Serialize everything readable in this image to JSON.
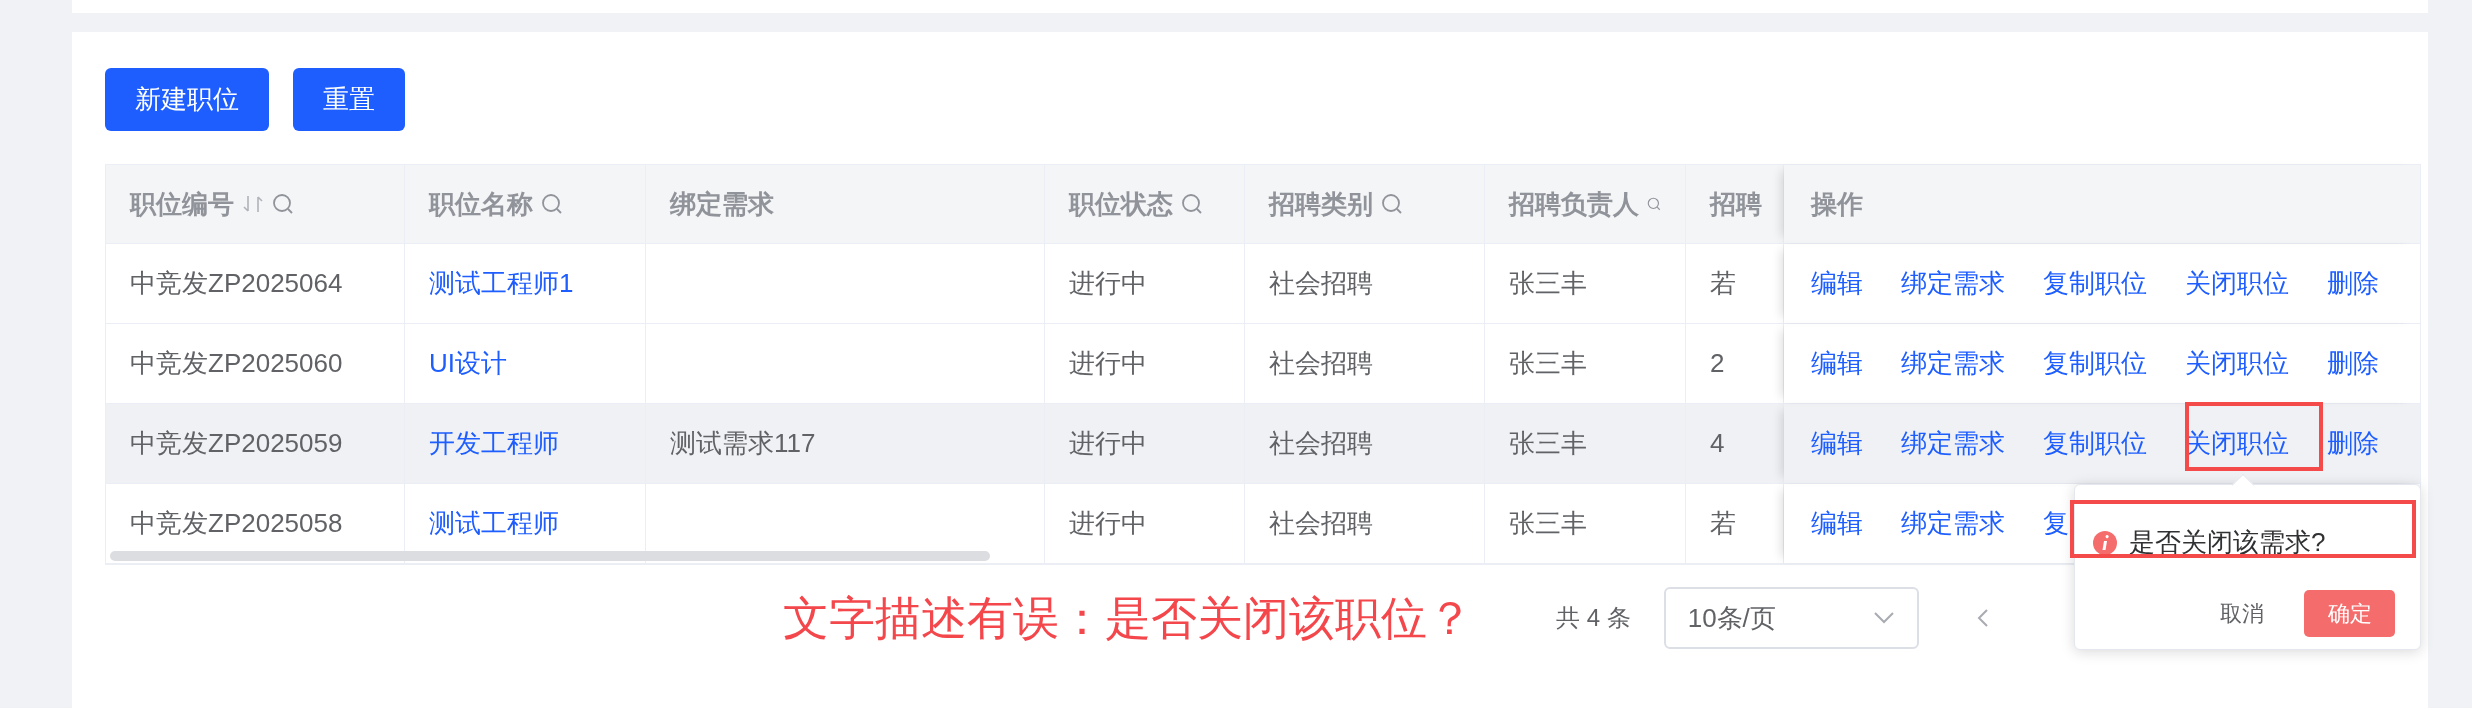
{
  "buttons": [
    {
      "label": "新建职位"
    },
    {
      "label": "重置"
    }
  ],
  "table": {
    "columns": [
      {
        "label": "职位编号",
        "kind": "text",
        "sort": true,
        "search": true
      },
      {
        "label": "职位名称",
        "kind": "link",
        "sort": false,
        "search": true
      },
      {
        "label": "绑定需求",
        "kind": "text",
        "sort": false,
        "search": false
      },
      {
        "label": "职位状态",
        "kind": "text",
        "sort": false,
        "search": true
      },
      {
        "label": "招聘类别",
        "kind": "text",
        "sort": false,
        "search": true
      },
      {
        "label": "招聘负责人",
        "kind": "text",
        "sort": false,
        "search": true
      },
      {
        "label": "招聘",
        "kind": "text",
        "sort": false,
        "search": false
      }
    ],
    "actions_header": "操作",
    "rows": [
      {
        "highlighted": false,
        "cells": [
          "中竞发ZP2025064",
          "测试工程师1",
          "",
          "进行中",
          "社会招聘",
          "张三丰",
          "若"
        ],
        "actions": [
          "编辑",
          "绑定需求",
          "复制职位",
          "关闭职位",
          "删除"
        ]
      },
      {
        "highlighted": false,
        "cells": [
          "中竞发ZP2025060",
          "UI设计",
          "",
          "进行中",
          "社会招聘",
          "张三丰",
          "2"
        ],
        "actions": [
          "编辑",
          "绑定需求",
          "复制职位",
          "关闭职位",
          "删除"
        ]
      },
      {
        "highlighted": true,
        "cells": [
          "中竞发ZP2025059",
          "开发工程师",
          "测试需求117",
          "进行中",
          "社会招聘",
          "张三丰",
          "4"
        ],
        "actions": [
          "编辑",
          "绑定需求",
          "复制职位",
          "关闭职位",
          "删除"
        ]
      },
      {
        "highlighted": false,
        "cells": [
          "中竞发ZP2025058",
          "测试工程师",
          "",
          "进行中",
          "社会招聘",
          "张三丰",
          "若"
        ],
        "actions": [
          "编辑",
          "绑定需求",
          "复"
        ]
      }
    ]
  },
  "annotation": {
    "text": "文字描述有误：是否关闭该职位？"
  },
  "pagination": {
    "total": "共 4 条",
    "page_size": "10条/页"
  },
  "popconfirm": {
    "message": "是否关闭该需求?",
    "cancel": "取消",
    "confirm": "确定"
  }
}
